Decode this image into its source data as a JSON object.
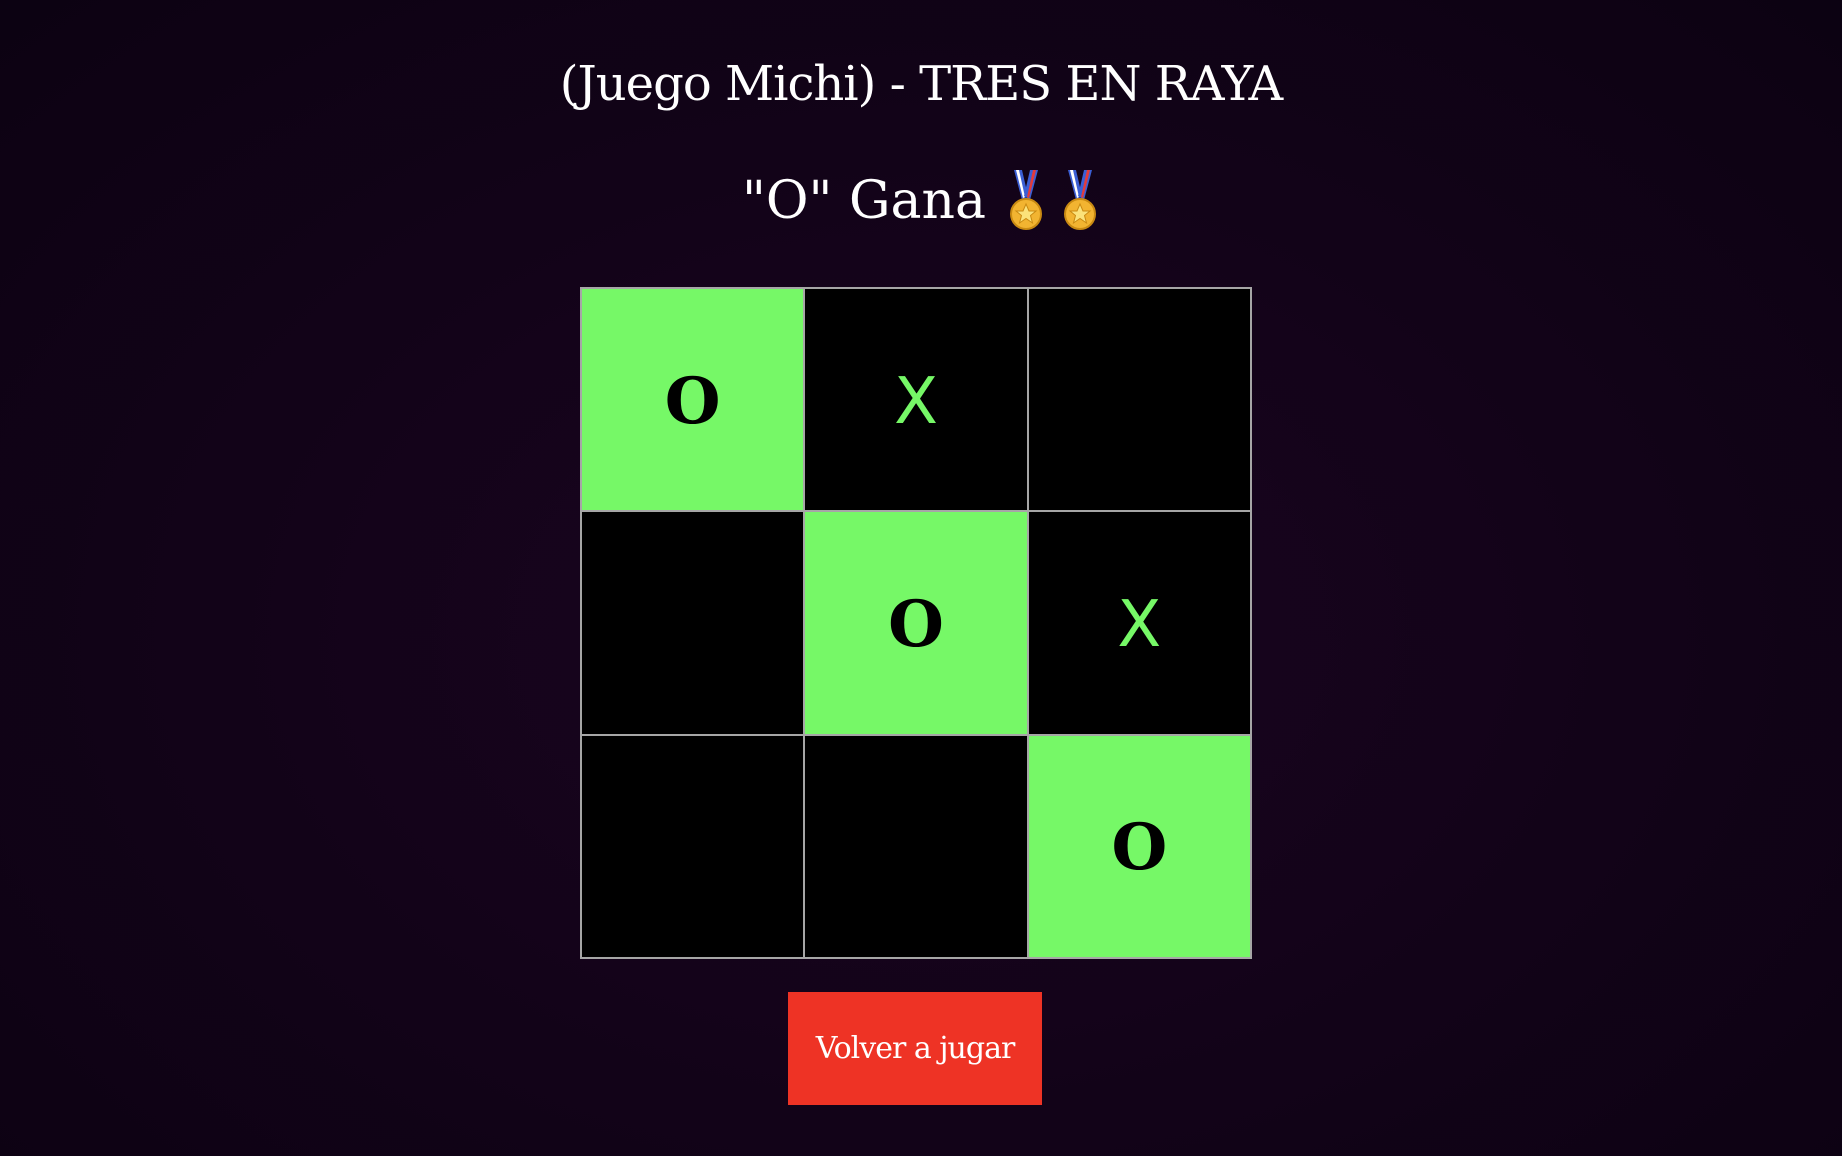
{
  "header": {
    "title": "(Juego Michi) - TRES EN RAYA",
    "status": "\"O\" Gana"
  },
  "medals": [
    {
      "icon": "medal-icon"
    },
    {
      "icon": "medal-icon"
    }
  ],
  "board": {
    "cells": [
      {
        "value": "O",
        "winning": true
      },
      {
        "value": "X",
        "winning": false
      },
      {
        "value": "",
        "winning": false
      },
      {
        "value": "",
        "winning": false
      },
      {
        "value": "O",
        "winning": true
      },
      {
        "value": "X",
        "winning": false
      },
      {
        "value": "",
        "winning": false
      },
      {
        "value": "",
        "winning": false
      },
      {
        "value": "O",
        "winning": true
      }
    ]
  },
  "controls": {
    "restart_label": "Volver a jugar"
  },
  "colors": {
    "background": "#120318",
    "win_cell": "#76f867",
    "x_mark": "#76f867",
    "o_mark": "#000000",
    "button": "#ee3325"
  }
}
